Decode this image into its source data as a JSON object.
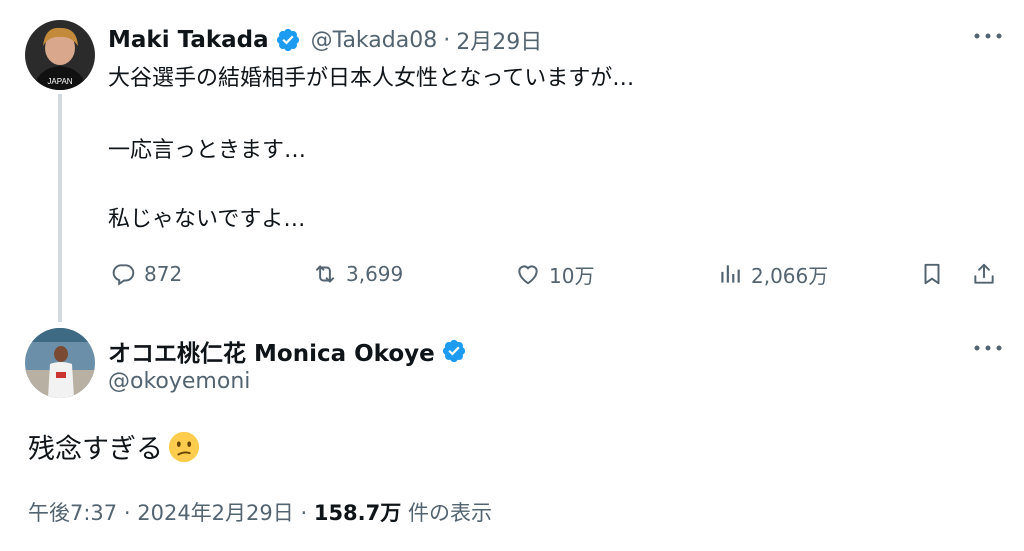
{
  "tweet": {
    "author_name": "Maki Takada",
    "handle": "@Takada08",
    "separator": "·",
    "date": "2月29日",
    "avatar_text": "JAPAN",
    "lines": [
      "大谷選手の結婚相手が日本人女性となっていますが…",
      "一応言っときます…",
      "私じゃないですよ…"
    ],
    "actions": {
      "replies": "872",
      "retweets": "3,699",
      "likes": "10万",
      "views": "2,066万"
    }
  },
  "reply": {
    "author_name": "オコエ桃仁花 Monica Okoye",
    "handle": "@okoyemoni",
    "text": "残念すぎる",
    "emoji": "confused-face",
    "time": "午後7:37",
    "separator": "·",
    "date": "2024年2月29日",
    "separator2": "·",
    "view_count": "158.7万",
    "view_suffix": "件の表示"
  },
  "colors": {
    "text": "#0f1419",
    "secondary": "#536471",
    "verified": "#1d9bf0",
    "thread_line": "#cfd9de"
  },
  "icons": [
    "verified-badge-icon",
    "more-icon",
    "reply-icon",
    "retweet-icon",
    "like-icon",
    "views-icon",
    "bookmark-icon",
    "share-icon"
  ]
}
